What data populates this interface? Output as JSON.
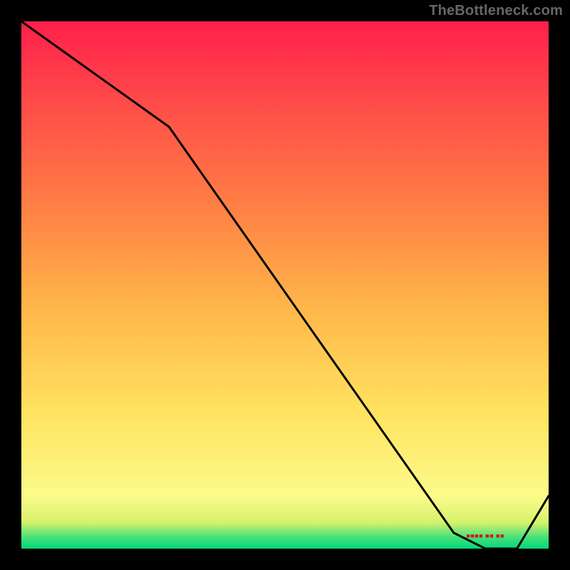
{
  "watermark": "TheBottleneck.com",
  "chart_data": {
    "type": "line",
    "title": "",
    "xlabel": "",
    "ylabel": "",
    "xlim": [
      0,
      100
    ],
    "ylim": [
      0,
      100
    ],
    "x": [
      0,
      28,
      82,
      88,
      94,
      100
    ],
    "values": [
      100,
      80,
      3,
      0,
      0,
      10
    ],
    "small_text": {
      "x_start": 82,
      "x_end": 94,
      "y": 2,
      "label": "unreadable-label"
    },
    "gradient_stops": [
      {
        "offset": 0.0,
        "color": "#05d77a"
      },
      {
        "offset": 0.02,
        "color": "#3fe07a"
      },
      {
        "offset": 0.05,
        "color": "#d7f26c"
      },
      {
        "offset": 0.1,
        "color": "#fcfb8b"
      },
      {
        "offset": 0.25,
        "color": "#ffe461"
      },
      {
        "offset": 0.45,
        "color": "#ffb84a"
      },
      {
        "offset": 0.65,
        "color": "#ff7f45"
      },
      {
        "offset": 0.85,
        "color": "#ff4a49"
      },
      {
        "offset": 1.0,
        "color": "#ff1f4c"
      }
    ]
  }
}
